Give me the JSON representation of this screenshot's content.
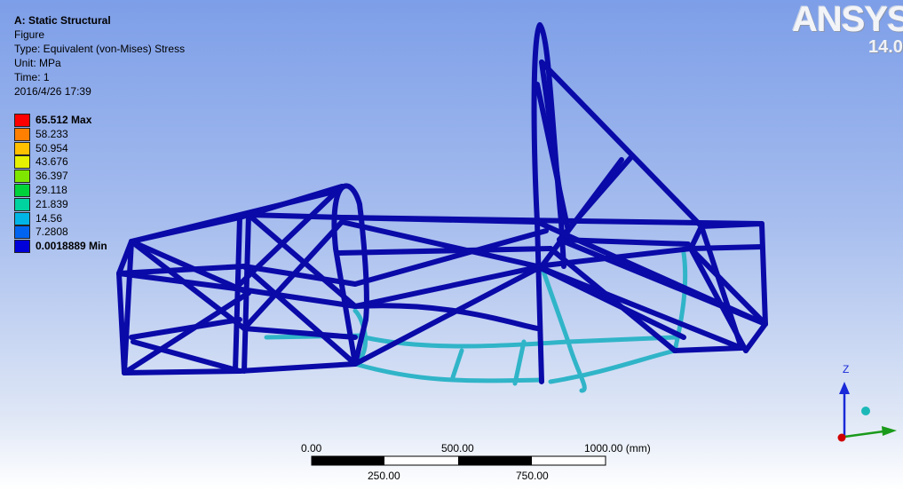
{
  "header": {
    "analysis": "A: Static Structural",
    "figure": "Figure",
    "type": "Type: Equivalent (von-Mises) Stress",
    "unit": "Unit: MPa",
    "time": "Time: 1",
    "date": "2016/4/26 17:39"
  },
  "legend": {
    "items": [
      {
        "label": "65.512 Max",
        "color": "#ff0000",
        "bold": true
      },
      {
        "label": "58.233",
        "color": "#ff7f00",
        "bold": false
      },
      {
        "label": "50.954",
        "color": "#ffc000",
        "bold": false
      },
      {
        "label": "43.676",
        "color": "#e6f000",
        "bold": false
      },
      {
        "label": "36.397",
        "color": "#7ee600",
        "bold": false
      },
      {
        "label": "29.118",
        "color": "#00d23c",
        "bold": false
      },
      {
        "label": "21.839",
        "color": "#00d2a0",
        "bold": false
      },
      {
        "label": "14.56",
        "color": "#00b4e6",
        "bold": false
      },
      {
        "label": "7.2808",
        "color": "#0064f0",
        "bold": false
      },
      {
        "label": "0.0018889 Min",
        "color": "#0000d8",
        "bold": true
      }
    ]
  },
  "logo": {
    "brand": "ANSYS",
    "version": "14.0"
  },
  "scale_bar": {
    "top_labels": [
      "0.00",
      "500.00",
      "1000.00 (mm)"
    ],
    "bottom_labels": [
      "250.00",
      "750.00"
    ]
  },
  "triad": {
    "z_label": "Z"
  },
  "colors": {
    "frame_tube": "#0a0aa8",
    "stressed_tube": "#2fa8c8",
    "accent_red": "#d00000"
  }
}
